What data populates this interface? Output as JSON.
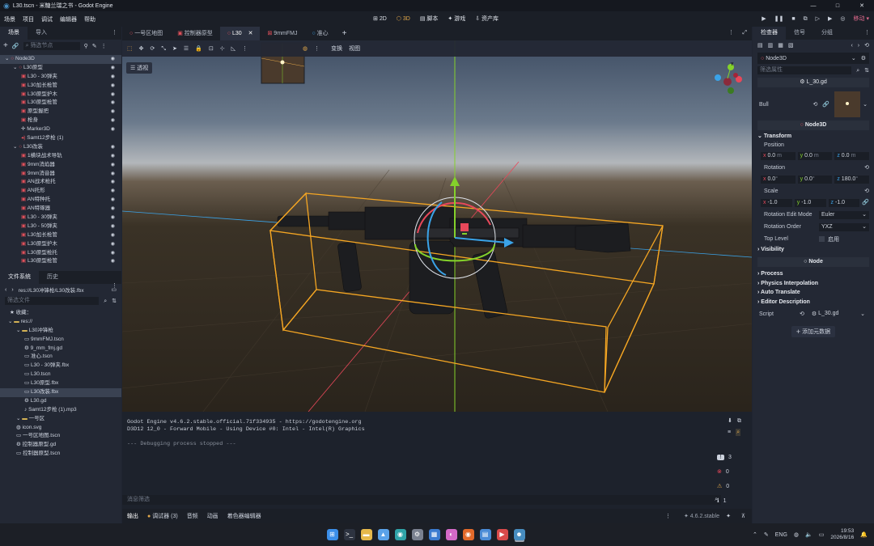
{
  "window": {
    "title": "L30.tscn - 米糖兰瑞之书 - Godot Engine",
    "controls": [
      "—",
      "□",
      "✕"
    ]
  },
  "menu": {
    "items": [
      "场景",
      "项目",
      "调试",
      "编辑器",
      "帮助"
    ],
    "modes": [
      "2D",
      "3D",
      "脚本",
      "游戏",
      "资产库"
    ],
    "active_mode": "3D",
    "renderer": "移动"
  },
  "scene_dock": {
    "tabs": [
      "场景",
      "导入"
    ],
    "filter_placeholder": "筛选节点",
    "nodes": [
      {
        "name": "Node3D",
        "depth": 0,
        "icon": "node3d-icon",
        "selected": true
      },
      {
        "name": "L30原型",
        "depth": 1,
        "icon": "node3d-icon"
      },
      {
        "name": "L30 - 30弹夹",
        "depth": 2,
        "icon": "mesh-icon"
      },
      {
        "name": "L30加长枪管",
        "depth": 2,
        "icon": "mesh-icon"
      },
      {
        "name": "L30原型护木",
        "depth": 2,
        "icon": "mesh-icon"
      },
      {
        "name": "L30原型枪管",
        "depth": 2,
        "icon": "mesh-icon"
      },
      {
        "name": "原型握把",
        "depth": 2,
        "icon": "mesh-icon"
      },
      {
        "name": "枪身",
        "depth": 2,
        "icon": "mesh-icon"
      },
      {
        "name": "Marker3D",
        "depth": 2,
        "icon": "marker-icon"
      },
      {
        "name": "Samt12步枪 (1)",
        "depth": 2,
        "icon": "audio-icon"
      },
      {
        "name": "L30改装",
        "depth": 1,
        "icon": "node3d-icon"
      },
      {
        "name": "1横块战术导轨",
        "depth": 2,
        "icon": "mesh-icon"
      },
      {
        "name": "9mm消焰器",
        "depth": 2,
        "icon": "mesh-icon"
      },
      {
        "name": "9mm消音器",
        "depth": 2,
        "icon": "mesh-icon"
      },
      {
        "name": "AN战术枪托",
        "depth": 2,
        "icon": "mesh-icon"
      },
      {
        "name": "AN托形",
        "depth": 2,
        "icon": "mesh-icon"
      },
      {
        "name": "AN特种托",
        "depth": 2,
        "icon": "mesh-icon"
      },
      {
        "name": "AN特琢器",
        "depth": 2,
        "icon": "mesh-icon"
      },
      {
        "name": "L30 - 30弹夹",
        "depth": 2,
        "icon": "mesh-icon"
      },
      {
        "name": "L30 - 50弹夹",
        "depth": 2,
        "icon": "mesh-icon"
      },
      {
        "name": "L30加长枪管",
        "depth": 2,
        "icon": "mesh-icon"
      },
      {
        "name": "L30原型护木",
        "depth": 2,
        "icon": "mesh-icon"
      },
      {
        "name": "L30原型枪托",
        "depth": 2,
        "icon": "mesh-icon"
      },
      {
        "name": "L30原型枪管",
        "depth": 2,
        "icon": "mesh-icon"
      }
    ]
  },
  "filesystem": {
    "tabs": [
      "文件系统",
      "历史"
    ],
    "path": "res://L30冲锋枪/L30改装.fbx",
    "filter_placeholder": "筛选文件",
    "favorites": "收藏：",
    "entries": [
      {
        "name": "res://",
        "depth": 0,
        "kind": "folder"
      },
      {
        "name": "L30冲锋枪",
        "depth": 1,
        "kind": "folder"
      },
      {
        "name": "9mmFMJ.tscn",
        "depth": 2,
        "kind": "scene"
      },
      {
        "name": "9_mm_fmj.gd",
        "depth": 2,
        "kind": "script"
      },
      {
        "name": "准心.tscn",
        "depth": 2,
        "kind": "scene"
      },
      {
        "name": "L30 - 30弹夹.fbx",
        "depth": 2,
        "kind": "model"
      },
      {
        "name": "L30.tscn",
        "depth": 2,
        "kind": "scene"
      },
      {
        "name": "L30原型.fbx",
        "depth": 2,
        "kind": "model"
      },
      {
        "name": "L30改装.fbx",
        "depth": 2,
        "kind": "model",
        "selected": true
      },
      {
        "name": "L30.gd",
        "depth": 2,
        "kind": "script"
      },
      {
        "name": "Samt12步枪 (1).mp3",
        "depth": 2,
        "kind": "audio"
      },
      {
        "name": "一号区",
        "depth": 1,
        "kind": "folder"
      },
      {
        "name": "icon.svg",
        "depth": 1,
        "kind": "image"
      },
      {
        "name": "一号区地图.tscn",
        "depth": 1,
        "kind": "scene"
      },
      {
        "name": "控制器原型.gd",
        "depth": 1,
        "kind": "script"
      },
      {
        "name": "控制器原型.tscn",
        "depth": 1,
        "kind": "scene"
      }
    ]
  },
  "editor_tabs": [
    {
      "label": "一号区地图",
      "active": false
    },
    {
      "label": "控制器原型",
      "active": false
    },
    {
      "label": "L30",
      "active": true
    },
    {
      "label": "9mmFMJ",
      "active": false
    },
    {
      "label": "准心",
      "active": false
    }
  ],
  "viewport": {
    "toolbar_menus": [
      "变换",
      "视图"
    ],
    "perspective_label": "透视",
    "gizmo_axes": [
      "Y",
      "X",
      "Z"
    ]
  },
  "output": {
    "lines": [
      "Godot Engine v4.6.2.stable.official.71f334935 - https://godotengine.org",
      "D3D12 12_0 - Forward Mobile - Using Device #0: Intel - Intel(R) Graphics",
      "",
      "--- Debugging process stopped ---"
    ],
    "filter_placeholder": "消息筛选",
    "counts": {
      "messages": "3",
      "errors": "0",
      "warnings": "0",
      "info": "1"
    },
    "bottom_tabs": [
      "输出",
      "调试器 (3)",
      "音频",
      "动画",
      "着色器编辑器"
    ],
    "version": "4.6.2.stable"
  },
  "inspector": {
    "tabs": [
      "检查器",
      "信号",
      "分组"
    ],
    "node_name": "Node3D",
    "filter_placeholder": "筛选属性",
    "script_resource": "L_30.gd",
    "bull_label": "Bull",
    "node3d_section": "Node3D",
    "transform": {
      "header": "Transform",
      "position_label": "Position",
      "position": {
        "x": "0.0",
        "y": "0.0",
        "z": "0.0",
        "unit": "m"
      },
      "rotation_label": "Rotation",
      "rotation": {
        "x": "0.0",
        "y": "0.0",
        "z": "180.0",
        "unit": "°"
      },
      "scale_label": "Scale",
      "scale": {
        "x": "-1.0",
        "y": "-1.0",
        "z": "-1.0"
      },
      "rotation_edit_mode_label": "Rotation Edit Mode",
      "rotation_edit_mode": "Euler",
      "rotation_order_label": "Rotation Order",
      "rotation_order": "YXZ",
      "top_level_label": "Top Level",
      "top_level_value": "启用"
    },
    "visibility": "Visibility",
    "node_section": "Node",
    "collapsed_sections": [
      "Process",
      "Physics Interpolation",
      "Auto Translate",
      "Editor Description"
    ],
    "script_label": "Script",
    "script_value": "L_30.gd",
    "add_metadata": "添加元数据"
  },
  "taskbar": {
    "lang": "ENG",
    "time": "19:53",
    "date": "2026/8/16",
    "apps": [
      "windows-start",
      "terminal",
      "file-explorer",
      "photos",
      "edge",
      "settings",
      "paint",
      "color-app",
      "firefox",
      "notepad",
      "media-player",
      "godot"
    ]
  },
  "colors": {
    "accent": "#e3a84a",
    "bbox": "#f5a623",
    "node_red": "#e0505a",
    "axis_y": "#84d12b",
    "axis_x": "#e8485a",
    "axis_z": "#3aa3e8"
  }
}
